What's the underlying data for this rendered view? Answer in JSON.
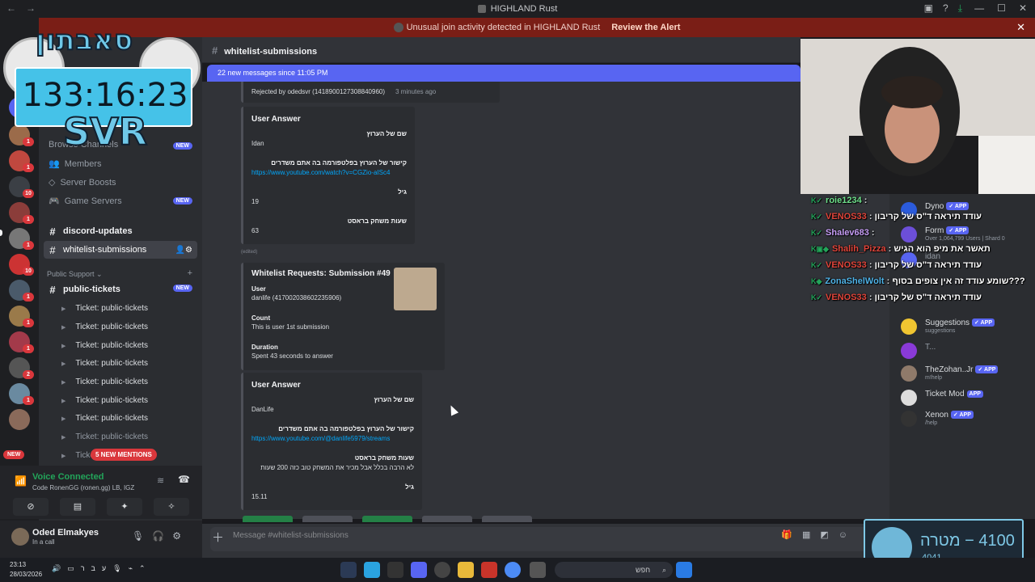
{
  "window": {
    "title": "HIGHLAND Rust"
  },
  "alert": {
    "text": "Unusual join activity detected in HIGHLAND Rust",
    "action": "Review the Alert"
  },
  "overlay": {
    "title": "סאבתון",
    "timer": "133:16:23",
    "tag": "SVR"
  },
  "sidebar": {
    "browse": "Browse Channels",
    "items": [
      {
        "label": "Members"
      },
      {
        "label": "Server Boosts"
      },
      {
        "label": "Game Servers",
        "badge": "NEW"
      }
    ],
    "browse_badge": "NEW",
    "channels": [
      {
        "name": "discord-updates"
      },
      {
        "name": "whitelist-submissions"
      }
    ],
    "category": "Public Support",
    "public_tickets": "public-tickets",
    "public_tickets_badge": "NEW",
    "tickets": [
      "Ticket: public-tickets",
      "Ticket: public-tickets",
      "Ticket: public-tickets",
      "Ticket: public-tickets",
      "Ticket: public-tickets",
      "Ticket: public-tickets",
      "Ticket: public-tickets",
      "Ticket: public-tickets",
      "Ticket: p"
    ],
    "mentions": "5 NEW MENTIONS",
    "new_pill": "NEW"
  },
  "voice": {
    "status": "Voice Connected",
    "server": "Code RonenGG (ronen.gg) LB, IGZ"
  },
  "user": {
    "name": "Oded Elmakyes",
    "status": "In a call"
  },
  "channel": {
    "name": "whitelist-submissions",
    "new_messages": "22 new messages since 11:05 PM"
  },
  "messages": {
    "rejected": "Rejected by odedsvr (1418900127308840960)",
    "rejected_time": "3 minutes ago",
    "edited": "(edited)",
    "answer1": {
      "title": "User Answer",
      "q1": "שם של הערוץ",
      "a1": "Idan",
      "q2": "קישור של הערוץ בפלטפורמה בה אתם משדרים",
      "a2": "https://www.youtube.com/watch?v=CGZio-aISc4",
      "q3": "גיל",
      "a3": "19",
      "q4": "שעות משחק בראסט",
      "a4": "63"
    },
    "submission": {
      "title": "Whitelist Requests: Submission #49",
      "user_label": "User",
      "user_value": "danlife (417002038602235906)",
      "count_label": "Count",
      "count_value": "This is user 1st submission",
      "duration_label": "Duration",
      "duration_value": "Spent 43 seconds to answer"
    },
    "answer2": {
      "title": "User Answer",
      "q1": "שם של הערוץ",
      "a1": "DanLife",
      "q2": "קישור של הערוץ בפלטפורמה בה אתם משדרים",
      "a2": "https://www.youtube.com/@danlife5979/streams",
      "q3": "שעות משחק בראסט",
      "a3": "לא הרבה בכלל אבל מכיר את המשחק טוב כזה 200 שעות",
      "q4": "גיל",
      "a4": "15.11"
    }
  },
  "composer": {
    "placeholder": "Message #whitelist-submissions"
  },
  "members": [
    {
      "name": "Dyno",
      "app": "✓ APP",
      "sub": ""
    },
    {
      "name": "Form",
      "app": "✓ APP",
      "sub": "Over 1,064,799 Users | Shard 0"
    },
    {
      "name": "idan",
      "app": "",
      "sub": ""
    },
    {
      "name": "Suggestions",
      "app": "✓ APP",
      "sub": "suggestions"
    },
    {
      "name": "T...",
      "app": "",
      "sub": ""
    },
    {
      "name": "TheZohan..Jr",
      "app": "✓ APP",
      "sub": "m!help"
    },
    {
      "name": "Ticket Mod",
      "app": "APP",
      "sub": ""
    },
    {
      "name": "Xenon",
      "app": "✓ APP",
      "sub": "/help"
    }
  ],
  "stream_chat": [
    {
      "user": "roie1234",
      "msg": "",
      "color": "#6fe08c"
    },
    {
      "user": "VENOS33",
      "msg": "עודד תיראה ד\"ס של קריבון",
      "color": "#e0443a"
    },
    {
      "user": "Shalev683",
      "msg": "",
      "color": "#c79ef7"
    },
    {
      "user": "Shalih_Pizza",
      "msg": "תאשר את מיפ הוא הגיש",
      "color": "#e0443a"
    },
    {
      "user": "VENOS33",
      "msg": "עודד תיראה ד\"ס של קריבון",
      "color": "#e0443a"
    },
    {
      "user": "ZonaShelWolt",
      "msg": "שומע עודד זה אין צופים בסוף???",
      "color": "#4fb3e8"
    },
    {
      "user": "VENOS33",
      "msg": "עודד תיראה ד\"ס של קריבון",
      "color": "#e0443a"
    }
  ],
  "goal": {
    "label": "4100 − מטרה",
    "current": "4041"
  },
  "taskbar": {
    "time": "23:13",
    "date": "28/03/2026",
    "lang": "עבר",
    "search": "חפש"
  },
  "colors": {
    "accent": "#5865f2",
    "alert": "#7a1e16",
    "online": "#23a55a",
    "danger": "#da373c"
  }
}
